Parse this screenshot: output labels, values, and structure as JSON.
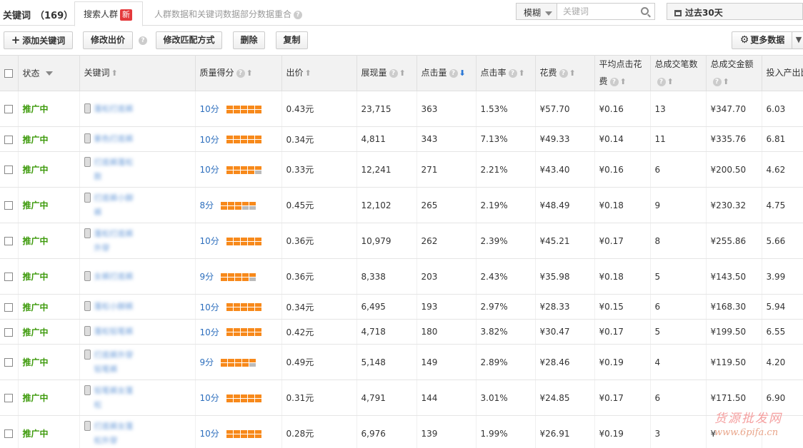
{
  "tabs": {
    "keywords_label": "关键词",
    "keywords_count": "（169）",
    "crowd_label": "搜索人群",
    "crowd_badge": "新",
    "note": "人群数据和关键词数据部分数据重合"
  },
  "filters": {
    "match_mode": "模糊",
    "keyword_placeholder": "关键词",
    "date_range": "过去30天"
  },
  "toolbar": {
    "add_keyword": "添加关键词",
    "edit_bid": "修改出价",
    "edit_match": "修改匹配方式",
    "delete": "删除",
    "copy": "复制",
    "more_data": "更多数据"
  },
  "table": {
    "headers": {
      "status": "状态",
      "keyword": "关键词",
      "quality": "质量得分",
      "bid": "出价",
      "impressions": "展现量",
      "clicks": "点击量",
      "ctr": "点击率",
      "cost": "花费",
      "avg_cpc": "平均点击花费",
      "orders": "总成交笔数",
      "gmv": "总成交金额",
      "roi": "投入产出比"
    },
    "rows": [
      {
        "status": "推广中",
        "keyword": "蓬松打底裤",
        "score": "10分",
        "level": 10,
        "bid": "0.43元",
        "impressions": "23,715",
        "clicks": "363",
        "ctr": "1.53%",
        "cost": "¥57.70",
        "cpc": "¥0.16",
        "orders": "13",
        "gmv": "¥347.70",
        "roi": "6.03"
      },
      {
        "status": "推广中",
        "keyword": "紫色打底裤",
        "score": "10分",
        "level": 10,
        "bid": "0.34元",
        "impressions": "4,811",
        "clicks": "343",
        "ctr": "7.13%",
        "cost": "¥49.33",
        "cpc": "¥0.14",
        "orders": "11",
        "gmv": "¥335.76",
        "roi": "6.81"
      },
      {
        "status": "推广中",
        "keyword": "打底裤蓬松款",
        "score": "10分",
        "level": 9,
        "bid": "0.33元",
        "impressions": "12,241",
        "clicks": "271",
        "ctr": "2.21%",
        "cost": "¥43.40",
        "cpc": "¥0.16",
        "orders": "6",
        "gmv": "¥200.50",
        "roi": "4.62"
      },
      {
        "status": "推广中",
        "keyword": "打底裤小脚裤",
        "score": "8分",
        "level": 8,
        "bid": "0.45元",
        "impressions": "12,102",
        "clicks": "265",
        "ctr": "2.19%",
        "cost": "¥48.49",
        "cpc": "¥0.18",
        "orders": "9",
        "gmv": "¥230.32",
        "roi": "4.75"
      },
      {
        "status": "推广中",
        "keyword": "蓬松打底裤外穿",
        "score": "10分",
        "level": 10,
        "bid": "0.36元",
        "impressions": "10,979",
        "clicks": "262",
        "ctr": "2.39%",
        "cost": "¥45.21",
        "cpc": "¥0.17",
        "orders": "8",
        "gmv": "¥255.86",
        "roi": "5.66"
      },
      {
        "status": "推广中",
        "keyword": "女裤打底裤",
        "score": "9分",
        "level": 9,
        "bid": "0.36元",
        "impressions": "8,338",
        "clicks": "203",
        "ctr": "2.43%",
        "cost": "¥35.98",
        "cpc": "¥0.18",
        "orders": "5",
        "gmv": "¥143.50",
        "roi": "3.99"
      },
      {
        "status": "推广中",
        "keyword": "蓬松小脚裤",
        "score": "10分",
        "level": 10,
        "bid": "0.34元",
        "impressions": "6,495",
        "clicks": "193",
        "ctr": "2.97%",
        "cost": "¥28.33",
        "cpc": "¥0.15",
        "orders": "6",
        "gmv": "¥168.30",
        "roi": "5.94"
      },
      {
        "status": "推广中",
        "keyword": "蓬松铅笔裤",
        "score": "10分",
        "level": 10,
        "bid": "0.42元",
        "impressions": "4,718",
        "clicks": "180",
        "ctr": "3.82%",
        "cost": "¥30.47",
        "cpc": "¥0.17",
        "orders": "5",
        "gmv": "¥199.50",
        "roi": "6.55"
      },
      {
        "status": "推广中",
        "keyword": "打底裤外穿铅笔裤",
        "score": "9分",
        "level": 9,
        "bid": "0.49元",
        "impressions": "5,148",
        "clicks": "149",
        "ctr": "2.89%",
        "cost": "¥28.46",
        "cpc": "¥0.19",
        "orders": "4",
        "gmv": "¥119.50",
        "roi": "4.20"
      },
      {
        "status": "推广中",
        "keyword": "铅笔裤女蓬松",
        "score": "10分",
        "level": 10,
        "bid": "0.31元",
        "impressions": "4,791",
        "clicks": "144",
        "ctr": "3.01%",
        "cost": "¥24.85",
        "cpc": "¥0.17",
        "orders": "6",
        "gmv": "¥171.50",
        "roi": "6.90"
      },
      {
        "status": "推广中",
        "keyword": "打底裤女蓬松外穿",
        "score": "10分",
        "level": 10,
        "bid": "0.28元",
        "impressions": "6,976",
        "clicks": "139",
        "ctr": "1.99%",
        "cost": "¥26.91",
        "cpc": "¥0.19",
        "orders": "3",
        "gmv": "¥",
        "roi": ""
      }
    ]
  },
  "watermark": {
    "line1": "货源批发网",
    "line2": "www.6pifa.cn"
  },
  "colors": {
    "status_green": "#3d9a0b",
    "score_blue": "#2c6ebd",
    "bar_orange": "#f7891b",
    "badge_red": "#e4393c"
  }
}
